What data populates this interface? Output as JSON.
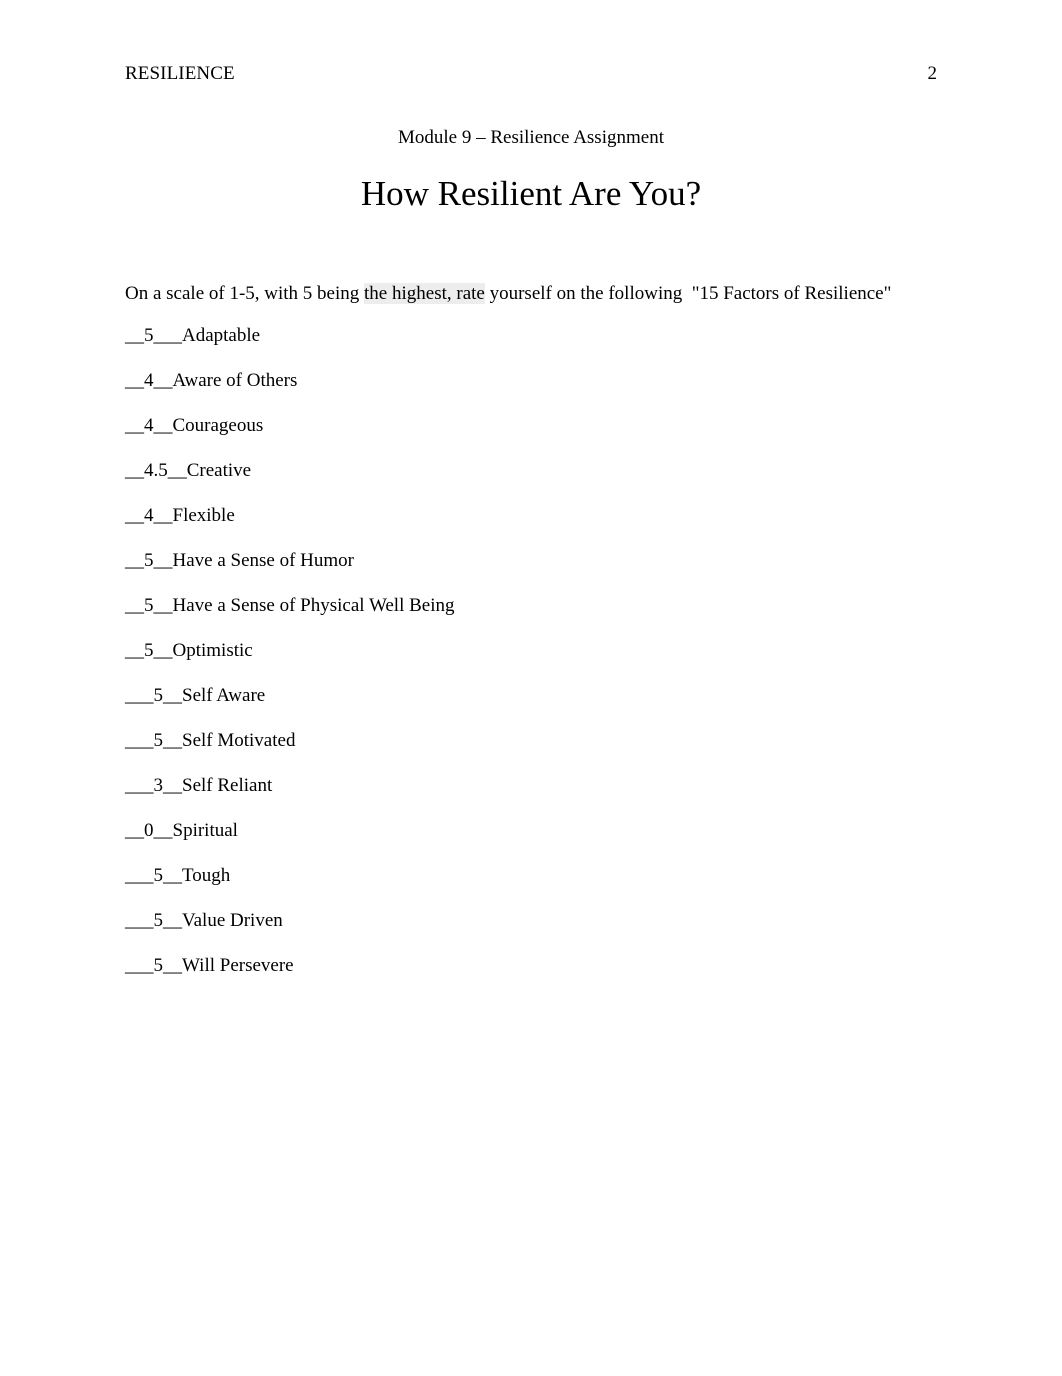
{
  "document": {
    "running_head": "RESILIENCE",
    "page_number": "2",
    "subtitle": "Module 9 – Resilience Assignment",
    "title": "How Resilient Are You?",
    "instruction_pre": "On a scale of 1-5, with 5 being ",
    "instruction_highlight": "the highest, rate",
    "instruction_post": " yourself on the following  \"15 Factors of Resilience\"",
    "instruction_full": "On a scale of 1-5, with 5 being the highest, rate yourself on the following  \"15 Factors of Resilience\"",
    "highlight_color": "#ededed",
    "text_color": "#000000",
    "background_color": "#ffffff"
  },
  "factors": [
    {
      "line": "__5___Adaptable",
      "rating": "5",
      "name": "Adaptable"
    },
    {
      "line": "__4__Aware of Others",
      "rating": "4",
      "name": "Aware of Others"
    },
    {
      "line": "__4__Courageous",
      "rating": "4",
      "name": "Courageous"
    },
    {
      "line": "__4.5__Creative",
      "rating": "4.5",
      "name": "Creative"
    },
    {
      "line": "__4__Flexible",
      "rating": "4",
      "name": "Flexible"
    },
    {
      "line": "__5__Have a Sense of Humor",
      "rating": "5",
      "name": "Have a Sense of Humor"
    },
    {
      "line": "__5__Have a Sense of Physical Well Being",
      "rating": "5",
      "name": "Have a Sense of Physical Well Being"
    },
    {
      "line": "__5__Optimistic",
      "rating": "5",
      "name": "Optimistic"
    },
    {
      "line": "___5__Self Aware",
      "rating": "5",
      "name": "Self Aware"
    },
    {
      "line": "___5__Self Motivated",
      "rating": "5",
      "name": "Self Motivated"
    },
    {
      "line": "___3__Self Reliant",
      "rating": "3",
      "name": "Self Reliant"
    },
    {
      "line": "__0__Spiritual",
      "rating": "0",
      "name": "Spiritual"
    },
    {
      "line": "___5__Tough",
      "rating": "5",
      "name": "Tough"
    },
    {
      "line": "___5__Value Driven",
      "rating": "5",
      "name": "Value Driven"
    },
    {
      "line": "___5__Will Persevere",
      "rating": "5",
      "name": "Will Persevere"
    }
  ]
}
